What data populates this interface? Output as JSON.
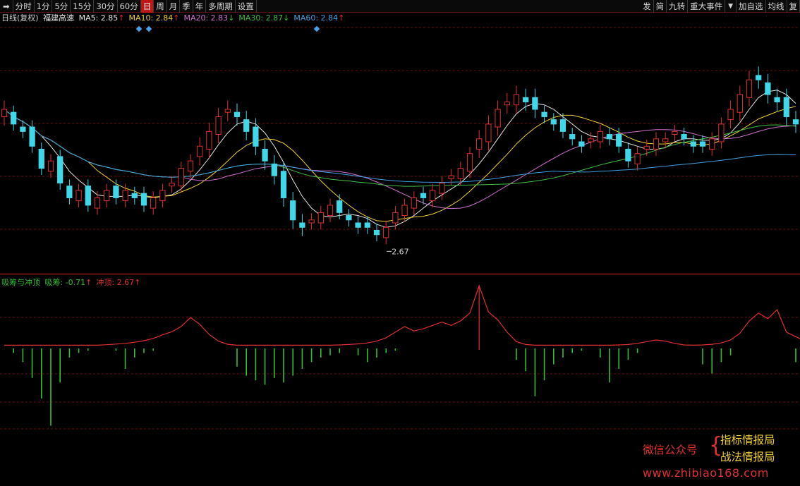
{
  "toolbar": {
    "left_items": [
      "分时",
      "1分",
      "5分",
      "15分",
      "30分",
      "60分",
      "日",
      "周",
      "月",
      "季",
      "年",
      "多周期",
      "设置"
    ],
    "active_item": "日",
    "right_items": [
      "发",
      "简",
      "九转",
      "重大事件"
    ],
    "right_items2": [
      "加自选",
      "均线",
      "复"
    ]
  },
  "main_legend": {
    "period": "日线(复权)",
    "stock_name": "福建高速",
    "ma": [
      {
        "label": "MA5: 2.85",
        "arrow": "↑",
        "color": "#e6e6e6",
        "arrow_color": "#e03030"
      },
      {
        "label": "MA10: 2.84",
        "arrow": "↑",
        "color": "#f0d030",
        "arrow_color": "#e03030"
      },
      {
        "label": "MA20: 2.83",
        "arrow": "↓",
        "color": "#d070d0",
        "arrow_color": "#30c030"
      },
      {
        "label": "MA30: 2.87",
        "arrow": "↓",
        "color": "#40c040",
        "arrow_color": "#30c030"
      },
      {
        "label": "MA60: 2.84",
        "arrow": "↑",
        "color": "#40a0e0",
        "arrow_color": "#e03030"
      }
    ]
  },
  "price_annotation": "2.67",
  "indicator_legend": {
    "name": "吸筹与冲顶",
    "items": [
      {
        "label": "吸筹: -0.71",
        "arrow": "↑",
        "color": "#30c030",
        "arrow_color": "#e03030"
      },
      {
        "label": "冲顶: 2.67",
        "arrow": "↑",
        "color": "#e03030",
        "arrow_color": "#e03030"
      }
    ]
  },
  "watermark": {
    "account": "微信公众号",
    "brace": "{",
    "name1": "指标情报局",
    "name2": "战法情报局",
    "url": "www.zhibiao168.com"
  },
  "colors": {
    "up": "#e03030",
    "down": "#40d8e8",
    "grid": "#6a0e0e",
    "ma5": "#e6e6e6",
    "ma10": "#f0d030",
    "ma20": "#d070d0",
    "ma30": "#40c040",
    "ma60": "#40a0e0",
    "accumulate": "#30c030",
    "peak": "#e03030"
  },
  "chart_data": {
    "type": "candlestick",
    "x_unit": "trading day index (0 = oldest visible)",
    "close": [
      2.84,
      2.82,
      2.81,
      2.79,
      2.76,
      2.77,
      2.74,
      2.72,
      2.73,
      2.71,
      2.72,
      2.73,
      2.72,
      2.73,
      2.72,
      2.71,
      2.72,
      2.73,
      2.74,
      2.76,
      2.77,
      2.79,
      2.81,
      2.83,
      2.84,
      2.83,
      2.81,
      2.79,
      2.77,
      2.75,
      2.72,
      2.69,
      2.68,
      2.69,
      2.7,
      2.71,
      2.7,
      2.69,
      2.68,
      2.68,
      2.67,
      2.68,
      2.7,
      2.71,
      2.72,
      2.72,
      2.73,
      2.74,
      2.75,
      2.76,
      2.78,
      2.8,
      2.82,
      2.84,
      2.85,
      2.86,
      2.85,
      2.84,
      2.83,
      2.82,
      2.81,
      2.8,
      2.79,
      2.8,
      2.81,
      2.8,
      2.79,
      2.77,
      2.78,
      2.79,
      2.8,
      2.8,
      2.81,
      2.8,
      2.79,
      2.79,
      2.8,
      2.82,
      2.84,
      2.86,
      2.88,
      2.88,
      2.86,
      2.85,
      2.83,
      2.82
    ],
    "volatility": [
      0.02,
      0.015,
      0.015,
      0.015,
      0.015,
      0.015,
      0.015,
      0.015,
      0.015,
      0.015,
      0.015,
      0.015,
      0.015,
      0.015,
      0.015,
      0.015,
      0.015,
      0.015,
      0.015,
      0.015,
      0.015,
      0.02,
      0.02,
      0.02,
      0.02,
      0.02,
      0.02,
      0.02,
      0.02,
      0.02,
      0.02,
      0.02,
      0.02,
      0.015,
      0.015,
      0.015,
      0.015,
      0.015,
      0.015,
      0.015,
      0.015,
      0.015,
      0.015,
      0.015,
      0.015,
      0.015,
      0.015,
      0.015,
      0.015,
      0.015,
      0.015,
      0.02,
      0.02,
      0.02,
      0.02,
      0.02,
      0.02,
      0.02,
      0.015,
      0.015,
      0.015,
      0.015,
      0.015,
      0.015,
      0.015,
      0.015,
      0.015,
      0.015,
      0.015,
      0.015,
      0.015,
      0.015,
      0.015,
      0.015,
      0.015,
      0.015,
      0.015,
      0.015,
      0.02,
      0.02,
      0.02,
      0.02,
      0.02,
      0.02,
      0.02,
      0.02
    ],
    "ylim": [
      2.62,
      2.95
    ],
    "indicator": {
      "peak_line": [
        0.02,
        0.02,
        0.02,
        0.02,
        0.02,
        0.02,
        0.02,
        0.02,
        0.02,
        0.02,
        0.02,
        0.04,
        0.07,
        0.1,
        0.15,
        0.22,
        0.32,
        0.48,
        0.62,
        0.85,
        1.25,
        0.95,
        0.5,
        0.2,
        0.06,
        0.02,
        0.02,
        0.02,
        0.02,
        0.02,
        0.02,
        0.02,
        0.02,
        0.02,
        0.02,
        0.02,
        0.03,
        0.05,
        0.08,
        0.12,
        0.2,
        0.35,
        0.6,
        0.85,
        0.65,
        0.75,
        0.9,
        1.05,
        0.9,
        1.1,
        1.45,
        2.67,
        1.5,
        1.15,
        0.6,
        0.18,
        0.05,
        0.02,
        0.02,
        0.02,
        0.02,
        0.02,
        0.02,
        0.02,
        0.02,
        0.02,
        0.03,
        0.05,
        0.1,
        0.18,
        0.25,
        0.2,
        0.1,
        0.03,
        0.02,
        0.03,
        0.06,
        0.12,
        0.25,
        0.55,
        1.1,
        1.45,
        1.2,
        1.6,
        0.6,
        0.4,
        0.2,
        0.05
      ],
      "accumulate_bars": [
        0,
        -0.2,
        -0.6,
        -1.3,
        -2.2,
        -3.4,
        -1.5,
        -0.4,
        -0.2,
        -0.1,
        0,
        0,
        -0.1,
        -0.9,
        -0.4,
        -0.2,
        -0.1,
        0,
        0,
        0,
        0,
        0,
        0,
        0,
        0,
        -0.8,
        -1.2,
        -1.4,
        -1.6,
        -1.3,
        -1.5,
        -1.2,
        -0.9,
        -0.6,
        -0.4,
        -0.3,
        -0.2,
        0,
        -0.3,
        -0.6,
        -0.4,
        -0.2,
        -0.1,
        0,
        0,
        0,
        0,
        0,
        0,
        0,
        0,
        0,
        0,
        0,
        0,
        -0.5,
        -1.0,
        -2.1,
        -1.4,
        -0.7,
        -0.4,
        -0.2,
        -0.1,
        0,
        -0.4,
        -1.5,
        -0.9,
        -0.5,
        -0.2,
        0,
        0,
        0,
        0,
        0,
        0,
        -0.7,
        -1.1,
        -0.6,
        -0.3,
        0,
        0,
        0,
        0,
        0,
        0,
        -0.6,
        -1.2,
        -0.8
      ],
      "accumulate_ylim": [
        -3.6,
        0
      ],
      "peak_ylim": [
        0,
        2.67
      ]
    }
  }
}
